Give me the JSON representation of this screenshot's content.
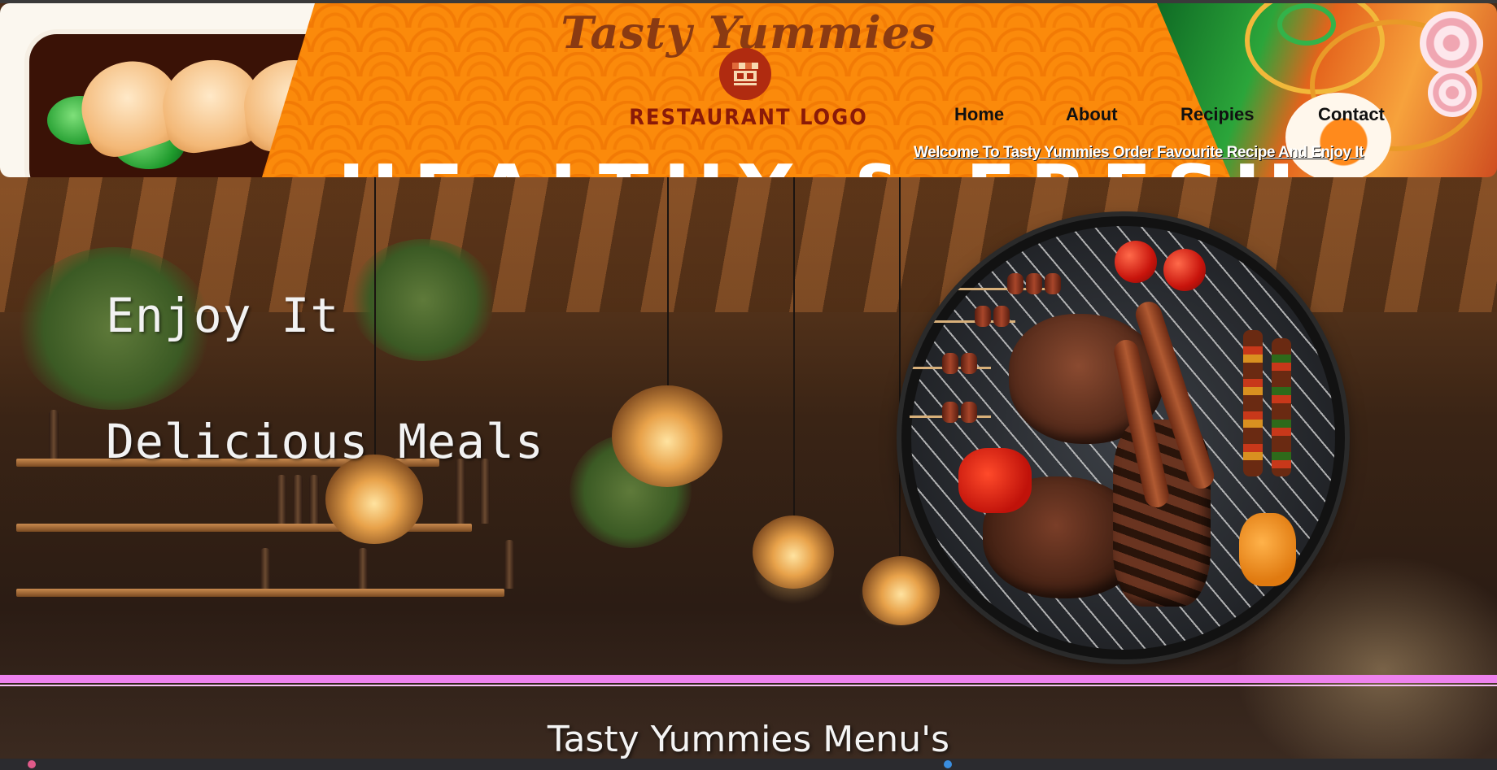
{
  "header": {
    "brand_title": "Tasty Yummies",
    "logo_text": "RESTAURANT LOGO",
    "nav": {
      "home": "Home",
      "about": "About",
      "recipes": "Recipies",
      "contact": "Contact"
    },
    "marquee": "Welcome To Tasty Yummies Order Favourite Recipe And Enjoy It",
    "hero_banner_peek": "HEALTHY & FRESH"
  },
  "hero": {
    "line1": "Enjoy It",
    "line2": "Delicious Meals"
  },
  "menu": {
    "heading": "Tasty Yummies Menu's"
  },
  "colors": {
    "banner_orange": "#fb8a0b",
    "brand_brown": "#8a3a12",
    "logo_red": "#b02b10",
    "divider_pink": "#ee82ee"
  },
  "icons": {
    "logo": "storefront-icon"
  }
}
